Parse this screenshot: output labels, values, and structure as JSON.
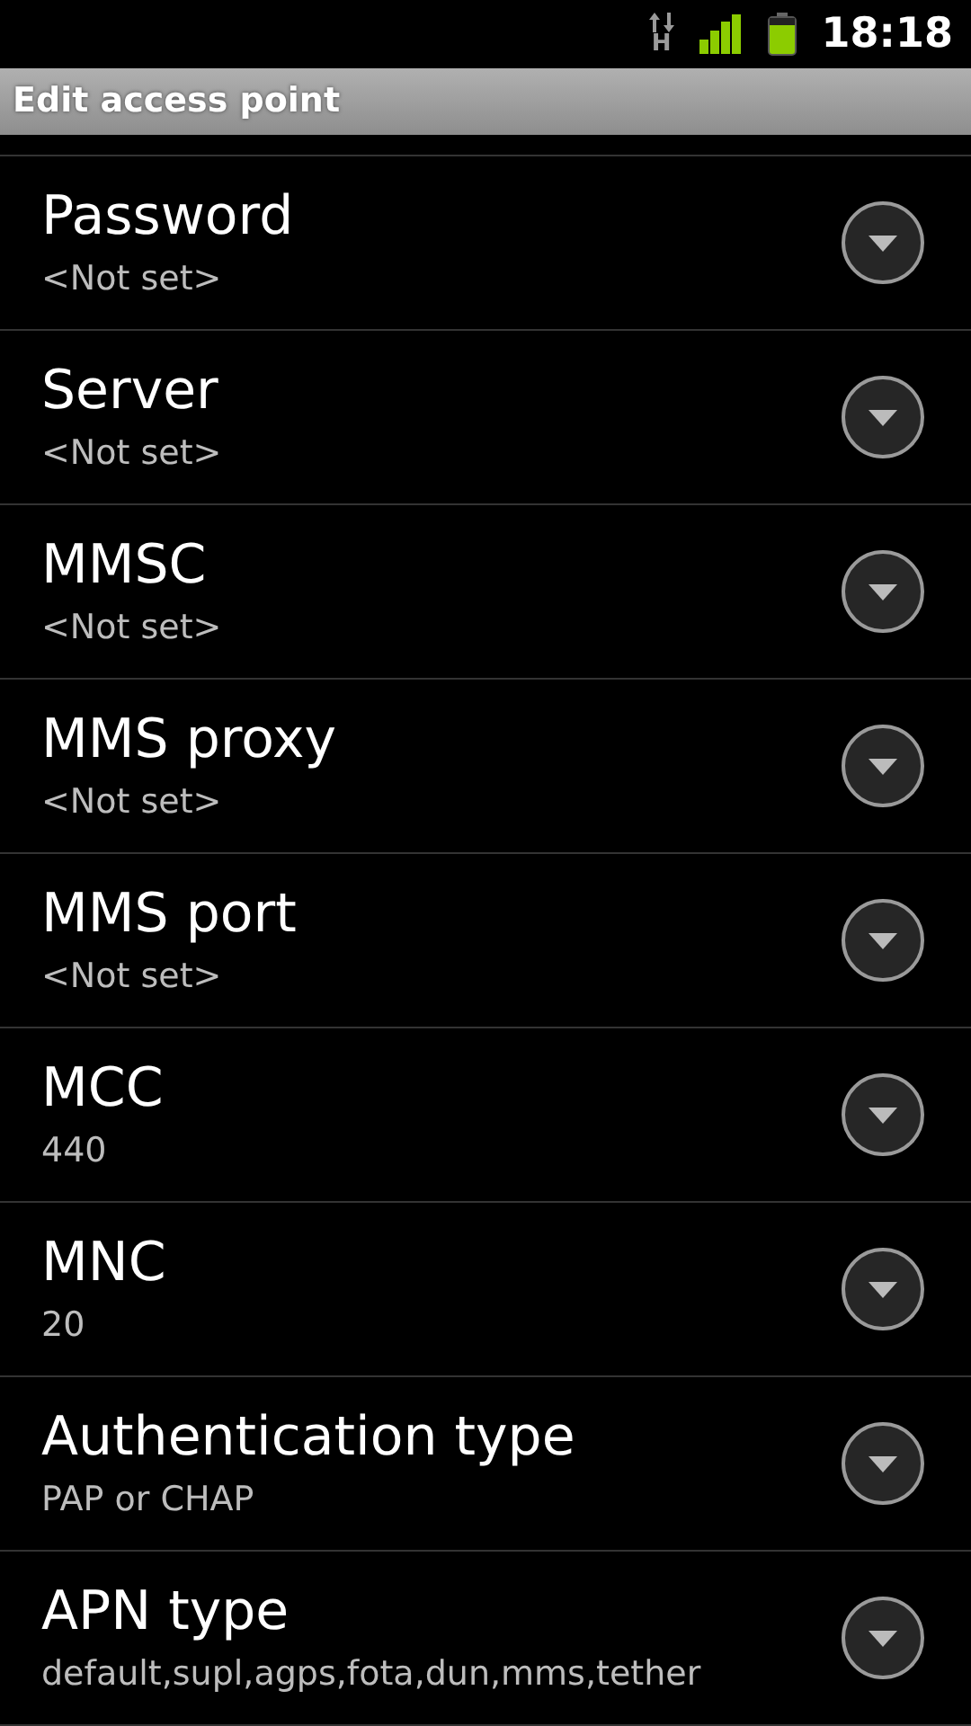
{
  "status_bar": {
    "network": "H",
    "time": "18:18"
  },
  "title": "Edit access point",
  "items": [
    {
      "title": "Password",
      "summary": "<Not set>"
    },
    {
      "title": "Server",
      "summary": "<Not set>"
    },
    {
      "title": "MMSC",
      "summary": "<Not set>"
    },
    {
      "title": "MMS proxy",
      "summary": "<Not set>"
    },
    {
      "title": "MMS port",
      "summary": "<Not set>"
    },
    {
      "title": "MCC",
      "summary": "440"
    },
    {
      "title": "MNC",
      "summary": "20"
    },
    {
      "title": "Authentication type",
      "summary": "PAP or CHAP"
    },
    {
      "title": "APN type",
      "summary": "default,supl,agps,fota,dun,mms,tether"
    }
  ]
}
